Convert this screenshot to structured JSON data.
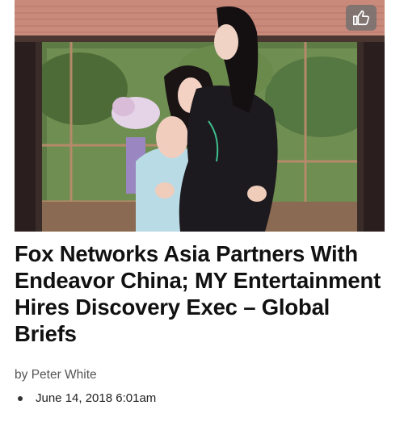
{
  "article": {
    "headline": "Fox Networks Asia Partners With Endeavor China; MY Entertainment Hires Discovery Exec – Global Briefs",
    "byline_prefix": "by",
    "author": "Peter White",
    "date": "June 14, 2018 6:01am"
  },
  "image": {
    "like_icon": "thumbs-up-icon"
  }
}
